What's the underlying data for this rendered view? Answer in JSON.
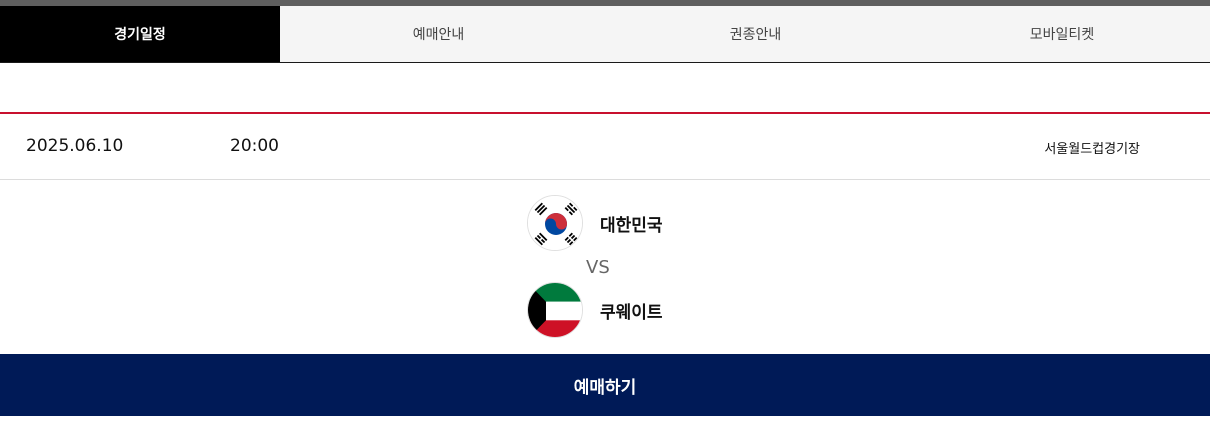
{
  "tabs": [
    {
      "label": "경기일정",
      "active": true
    },
    {
      "label": "예매안내",
      "active": false
    },
    {
      "label": "권종안내",
      "active": false
    },
    {
      "label": "모바일티켓",
      "active": false
    }
  ],
  "match": {
    "date": "2025.06.10",
    "time": "20:00",
    "venue": "서울월드컵경기장",
    "home_team": {
      "name": "대한민국",
      "flag_icon": "korea-flag-icon"
    },
    "vs_label": "VS",
    "away_team": {
      "name": "쿠웨이트",
      "flag_icon": "kuwait-flag-icon"
    }
  },
  "cta": {
    "label": "예매하기"
  },
  "colors": {
    "accent_red": "#c8102e",
    "navy": "#001a57",
    "active_tab_bg": "#000000",
    "inactive_tab_bg": "#f5f5f5"
  }
}
